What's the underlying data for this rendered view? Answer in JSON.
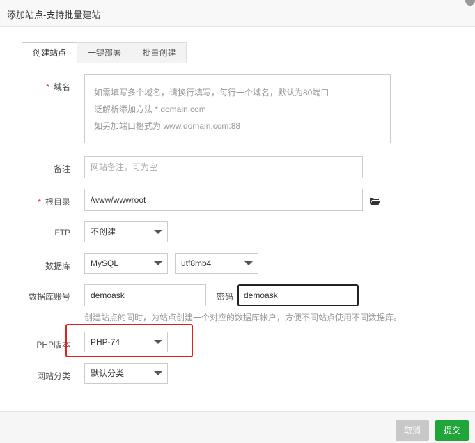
{
  "dialog": {
    "title": "添加站点-支持批量建站"
  },
  "tabs": [
    {
      "label": "创建站点",
      "active": true
    },
    {
      "label": "一键部署",
      "active": false
    },
    {
      "label": "批量创建",
      "active": false
    }
  ],
  "form": {
    "domain": {
      "label": "域名",
      "required_mark": "*",
      "placeholder_lines": [
        "如需填写多个域名，请换行填写，每行一个域名，默认为80端口",
        "泛解析添加方法 *.domain.com",
        "如另加端口格式为 www.domain.com:88"
      ]
    },
    "remark": {
      "label": "备注",
      "placeholder": "网站备注，可为空"
    },
    "root": {
      "label": "根目录",
      "required_mark": "*",
      "value": "/www/wwwroot"
    },
    "ftp": {
      "label": "FTP",
      "selected": "不创建"
    },
    "database": {
      "label": "数据库",
      "type_selected": "MySQL",
      "charset_selected": "utf8mb4"
    },
    "db_account": {
      "label": "数据库账号",
      "user_value": "demoask",
      "password_label": "密码",
      "password_value": "demoask",
      "hint": "创建站点的同时，为站点创建一个对应的数据库帐户，方便不同站点使用不同数据库。"
    },
    "php": {
      "label": "PHP版本",
      "selected": "PHP-74"
    },
    "category": {
      "label": "网站分类",
      "selected": "默认分类"
    }
  },
  "footer": {
    "cancel_label": "取消",
    "submit_label": "提交"
  },
  "colors": {
    "accent_green": "#20a53a",
    "highlight_red": "#e0201c",
    "required_red": "#e23"
  }
}
